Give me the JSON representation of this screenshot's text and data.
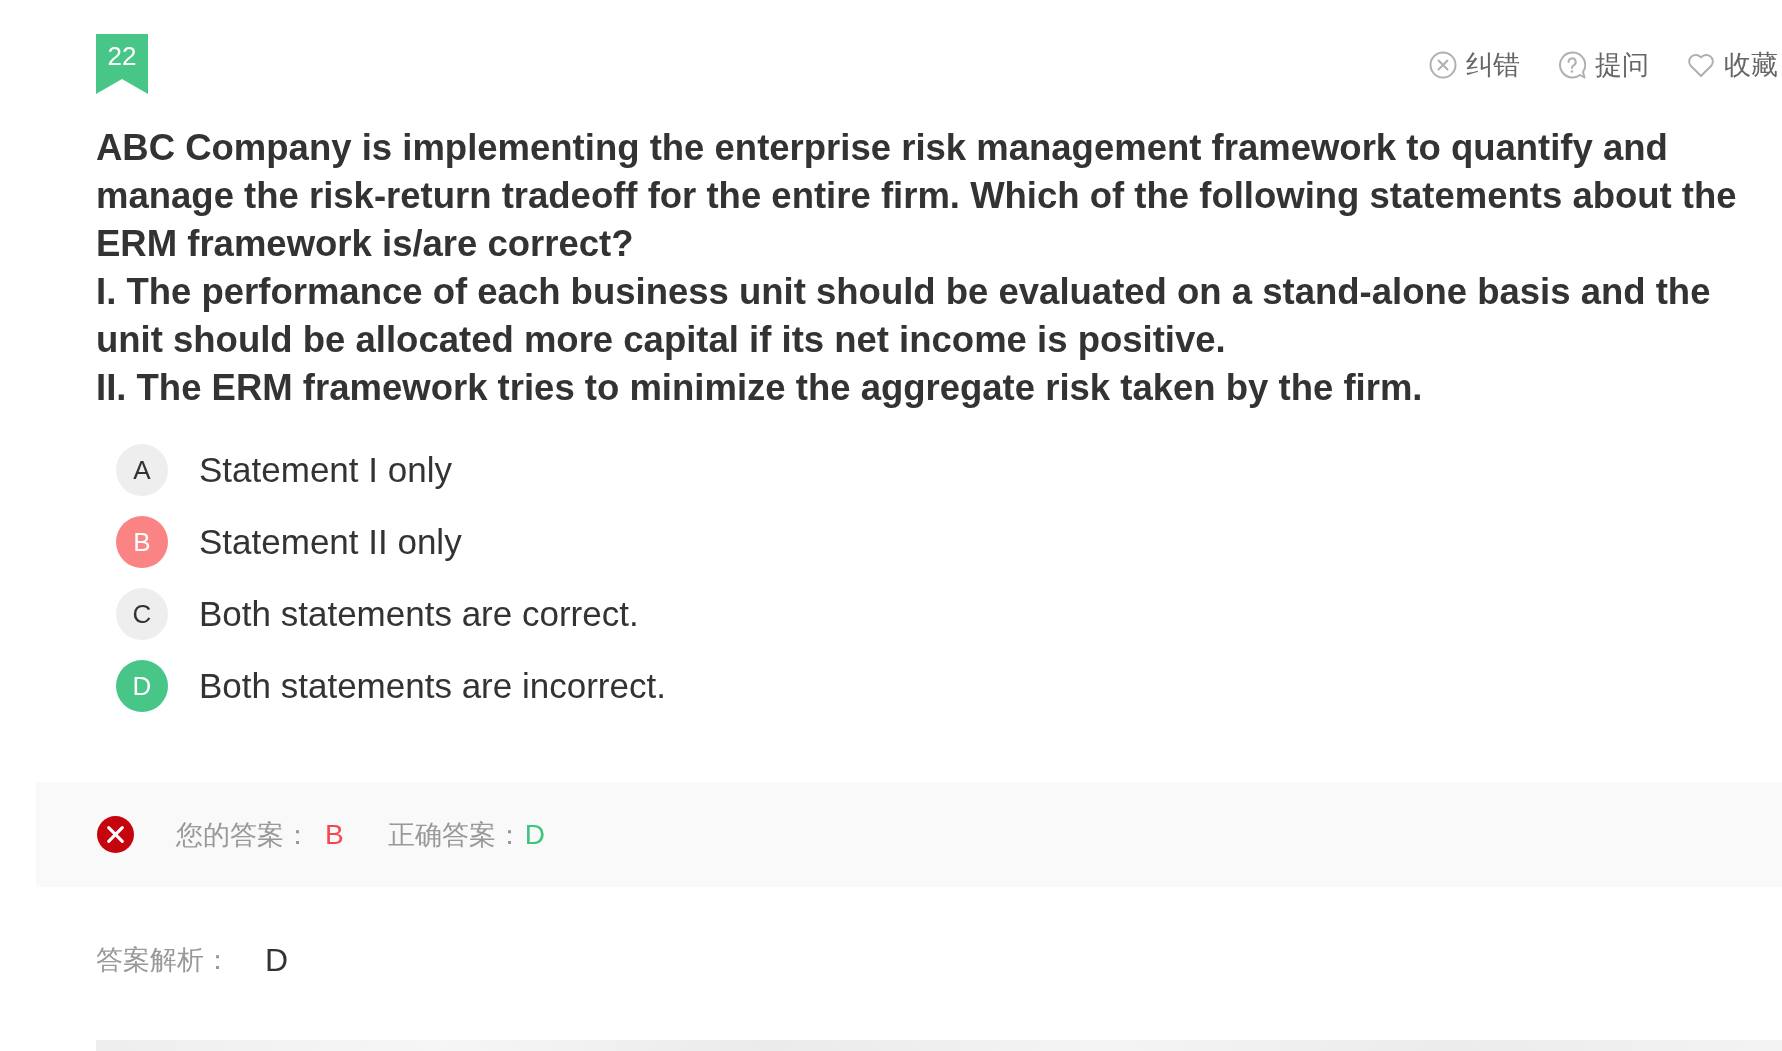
{
  "question": {
    "number": "22",
    "stem": "ABC Company is implementing the enterprise risk management framework to quantify and manage the risk-return tradeoff for the entire firm. Which of the following statements about the ERM framework is/are correct?",
    "statements": [
      "I. The performance of each business unit should be evaluated on a stand-alone basis and the unit should be allocated more capital if its net income is positive.",
      "II. The ERM framework tries to minimize the aggregate risk taken by the firm."
    ]
  },
  "actions": [
    {
      "kind": "report",
      "label": "纠错"
    },
    {
      "kind": "ask",
      "label": "提问"
    },
    {
      "kind": "favorite",
      "label": "收藏"
    }
  ],
  "options": [
    {
      "letter": "A",
      "text": "Statement I only",
      "selected": false,
      "correct": false
    },
    {
      "letter": "B",
      "text": "Statement II only",
      "selected": true,
      "correct": false
    },
    {
      "letter": "C",
      "text": "Both statements are correct.",
      "selected": false,
      "correct": false
    },
    {
      "letter": "D",
      "text": "Both statements are incorrect.",
      "selected": false,
      "correct": true
    }
  ],
  "result": {
    "correct": false,
    "your_answer_label": "您的答案：",
    "your_answer": "B",
    "correct_answer_label": "正确答案：",
    "correct_answer": "D"
  },
  "explanation": {
    "label": "答案解析：",
    "text": "D"
  }
}
